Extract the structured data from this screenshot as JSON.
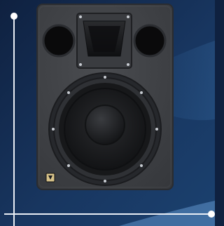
{
  "image": {
    "subject": "studio-monitor-speaker",
    "colors": {
      "background_dark": "#0f2140",
      "background_mid": "#1d3f6b",
      "background_light": "#2f5f93",
      "cabinet": "#3f4145",
      "cabinet_edge": "#2a2c30",
      "cone": "#151618",
      "surround": "#2b2d31",
      "accent_line": "#e9eef5"
    },
    "parts": [
      "horn-tweeter",
      "left-port",
      "right-port",
      "woofer",
      "dust-cap",
      "badge"
    ]
  }
}
